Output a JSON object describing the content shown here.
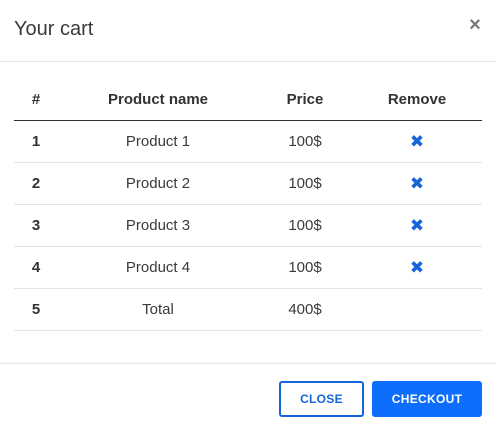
{
  "header": {
    "title": "Your cart",
    "close_glyph": "×"
  },
  "table": {
    "columns": [
      "#",
      "Product name",
      "Price",
      "Remove"
    ],
    "rows": [
      {
        "num": "1",
        "name": "Product 1",
        "price": "100$",
        "remove_icon": "close-icon"
      },
      {
        "num": "2",
        "name": "Product 2",
        "price": "100$",
        "remove_icon": "close-icon"
      },
      {
        "num": "3",
        "name": "Product 3",
        "price": "100$",
        "remove_icon": "close-icon"
      },
      {
        "num": "4",
        "name": "Product 4",
        "price": "100$",
        "remove_icon": "close-icon"
      },
      {
        "num": "5",
        "name": "Total",
        "price": "400$"
      }
    ],
    "remove_glyph": "✖"
  },
  "footer": {
    "close_label": "CLOSE",
    "checkout_label": "CHECKOUT"
  },
  "colors": {
    "accent": "#0d6efd",
    "remove_icon": "#1565d8"
  }
}
